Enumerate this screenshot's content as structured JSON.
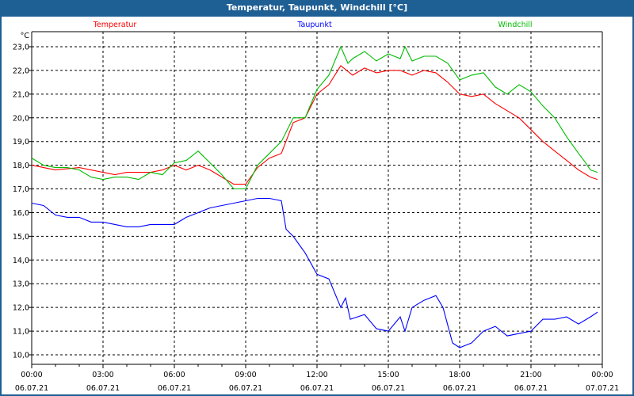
{
  "window": {
    "title": "Temperatur, Taupunkt, Windchill [°C]"
  },
  "chart_data": {
    "type": "line",
    "title": "Temperatur, Taupunkt, Windchill [°C]",
    "ylabel": "°C",
    "xlabel": "",
    "ylim": [
      9.6,
      23.6
    ],
    "xlim_hours": [
      0,
      24
    ],
    "grid": true,
    "yticks": [
      10,
      11,
      12,
      13,
      14,
      15,
      16,
      17,
      18,
      19,
      20,
      21,
      22,
      23
    ],
    "ytick_labels": [
      "10,0",
      "11,0",
      "12,0",
      "13,0",
      "14,0",
      "15,0",
      "16,0",
      "17,0",
      "18,0",
      "19,0",
      "20,0",
      "21,0",
      "22,0",
      "23,0"
    ],
    "xticks": [
      {
        "h": 0,
        "time": "00:00",
        "date": "06.07.21"
      },
      {
        "h": 3,
        "time": "03:00",
        "date": "06.07.21"
      },
      {
        "h": 6,
        "time": "06:00",
        "date": "06.07.21"
      },
      {
        "h": 9,
        "time": "09:00",
        "date": "06.07.21"
      },
      {
        "h": 12,
        "time": "12:00",
        "date": "06.07.21"
      },
      {
        "h": 15,
        "time": "15:00",
        "date": "06.07.21"
      },
      {
        "h": 18,
        "time": "18:00",
        "date": "06.07.21"
      },
      {
        "h": 21,
        "time": "21:00",
        "date": "06.07.21"
      },
      {
        "h": 24,
        "time": "00:00",
        "date": "07.07.21"
      }
    ],
    "series": [
      {
        "name": "Temperatur",
        "color": "#ff0000",
        "legend_pos": "top-left",
        "x": [
          0,
          1,
          2,
          3,
          3.5,
          4,
          5,
          5.5,
          6,
          6.5,
          7,
          7.5,
          8,
          8.5,
          9,
          9.5,
          10,
          10.5,
          11,
          11.5,
          12,
          12.5,
          13,
          13.5,
          14,
          14.5,
          15,
          15.5,
          16,
          16.5,
          17,
          17.5,
          18,
          18.5,
          19,
          19.5,
          20,
          20.5,
          21,
          21.5,
          22,
          22.5,
          23,
          23.5,
          23.8
        ],
        "values": [
          18.0,
          17.8,
          17.9,
          17.7,
          17.6,
          17.7,
          17.7,
          17.8,
          18.0,
          17.8,
          18.0,
          17.8,
          17.5,
          17.2,
          17.2,
          17.9,
          18.3,
          18.5,
          19.8,
          20.0,
          21.0,
          21.4,
          22.2,
          21.8,
          22.1,
          21.9,
          22.0,
          22.0,
          21.8,
          22.0,
          21.9,
          21.5,
          21.0,
          20.9,
          21.0,
          20.6,
          20.3,
          20.0,
          19.5,
          19.0,
          18.6,
          18.2,
          17.8,
          17.5,
          17.4
        ]
      },
      {
        "name": "Taupunkt",
        "color": "#0000ff",
        "legend_pos": "top-center",
        "x": [
          0,
          0.5,
          1,
          1.5,
          2,
          2.5,
          3,
          3.5,
          4,
          4.5,
          5,
          5.5,
          6,
          6.5,
          7,
          7.5,
          8,
          8.5,
          9,
          9.5,
          10,
          10.5,
          10.7,
          11,
          11.5,
          12,
          12.5,
          13,
          13.2,
          13.4,
          14,
          14.5,
          15,
          15.5,
          15.7,
          16,
          16.5,
          17,
          17.3,
          17.7,
          18,
          18.5,
          19,
          19.5,
          20,
          20.5,
          21,
          21.5,
          22,
          22.5,
          23,
          23.5,
          23.8
        ],
        "values": [
          16.4,
          16.3,
          15.9,
          15.8,
          15.8,
          15.6,
          15.6,
          15.5,
          15.4,
          15.4,
          15.5,
          15.5,
          15.5,
          15.8,
          16.0,
          16.2,
          16.3,
          16.4,
          16.5,
          16.6,
          16.6,
          16.5,
          15.3,
          15.0,
          14.3,
          13.4,
          13.2,
          12.0,
          12.4,
          11.5,
          11.7,
          11.1,
          11.0,
          11.6,
          11.0,
          12.0,
          12.3,
          12.5,
          12.0,
          10.5,
          10.3,
          10.5,
          11.0,
          11.2,
          10.8,
          10.9,
          11.0,
          11.5,
          11.5,
          11.6,
          11.3,
          11.6,
          11.8
        ]
      },
      {
        "name": "Windchill",
        "color": "#00bb00",
        "legend_pos": "top-right",
        "x": [
          0,
          0.5,
          1,
          1.5,
          2,
          2.5,
          3,
          3.5,
          4,
          4.5,
          5,
          5.5,
          6,
          6.5,
          7,
          7.5,
          8,
          8.5,
          9,
          9.5,
          10,
          10.5,
          11,
          11.5,
          12,
          12.5,
          13,
          13.3,
          13.5,
          14,
          14.5,
          15,
          15.5,
          15.7,
          16,
          16.5,
          17,
          17.5,
          18,
          18.5,
          19,
          19.5,
          20,
          20.5,
          21,
          21.5,
          22,
          22.5,
          23,
          23.3,
          23.5,
          23.8
        ],
        "values": [
          18.3,
          18.0,
          17.9,
          17.9,
          17.8,
          17.5,
          17.4,
          17.5,
          17.5,
          17.4,
          17.7,
          17.6,
          18.1,
          18.2,
          18.6,
          18.1,
          17.6,
          17.0,
          17.0,
          18.0,
          18.5,
          19.0,
          20.0,
          20.0,
          21.2,
          21.8,
          23.0,
          22.3,
          22.5,
          22.8,
          22.4,
          22.7,
          22.5,
          23.0,
          22.4,
          22.6,
          22.6,
          22.3,
          21.6,
          21.8,
          21.9,
          21.3,
          21.0,
          21.4,
          21.1,
          20.5,
          20.0,
          19.2,
          18.5,
          18.1,
          17.8,
          17.7
        ]
      }
    ]
  }
}
